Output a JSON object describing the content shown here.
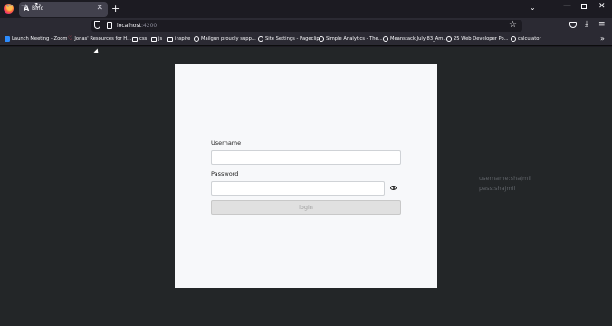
{
  "browser": {
    "tab": {
      "icon": "A",
      "title": "Bind",
      "close": "✕"
    },
    "new_tab": "+",
    "tablist": "⌄",
    "window_controls": {
      "minimize": "—",
      "close": "✕"
    },
    "nav": {
      "back": "←",
      "forward": "→",
      "reload": "↻"
    },
    "url": {
      "host": "localhost",
      "port": ":4200"
    },
    "bookmark_star": "☆",
    "download": "⤓",
    "menu": "≡",
    "bookmarks": [
      {
        "label": "Launch Meeting - Zoom",
        "icon": "zoom-icon"
      },
      {
        "label": "Jonas' Resources for H...",
        "icon": "heart-icon"
      },
      {
        "label": "css",
        "icon": "folder-icon"
      },
      {
        "label": "js",
        "icon": "folder-icon"
      },
      {
        "label": "inspire",
        "icon": "folder-icon"
      },
      {
        "label": "Mailgun proudly supp...",
        "icon": "globe-icon"
      },
      {
        "label": "Site Settings - Pageclip",
        "icon": "globe-icon"
      },
      {
        "label": "Simple Analytics - The...",
        "icon": "globe-icon"
      },
      {
        "label": "Meanstack July 83_Am...",
        "icon": "globe-icon"
      },
      {
        "label": "25 Web Developer Po...",
        "icon": "globe-icon"
      },
      {
        "label": "calculator",
        "icon": "globe-icon"
      }
    ],
    "bookmarks_overflow": "»"
  },
  "form": {
    "username_label": "Username",
    "username_value": "",
    "password_label": "Password",
    "password_value": "",
    "login_label": "login"
  },
  "hints": {
    "username": "username:shajmil",
    "password": "pass:shajmil"
  }
}
